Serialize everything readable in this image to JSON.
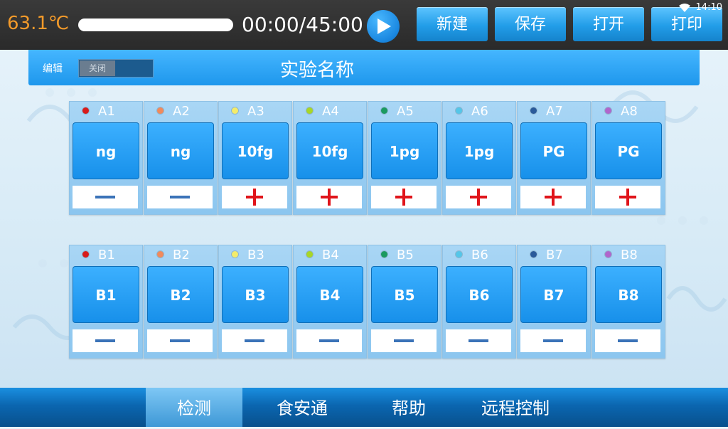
{
  "top": {
    "temperature": "63.1℃",
    "progress": 0.0,
    "timer": "00:00/45:00",
    "status_time": "14:10",
    "buttons": {
      "new": "新建",
      "save": "保存",
      "open": "打开",
      "print": "打印"
    }
  },
  "title_bar": {
    "edit_label": "编辑",
    "toggle_state": "关闭",
    "experiment_name": "实验名称"
  },
  "wells": {
    "row_a": [
      {
        "id": "A1",
        "name": "ng",
        "result": "negative",
        "dot": "#d81b1b"
      },
      {
        "id": "A2",
        "name": "ng",
        "result": "negative",
        "dot": "#f08a5d"
      },
      {
        "id": "A3",
        "name": "10fg",
        "result": "positive",
        "dot": "#f4ec6a"
      },
      {
        "id": "A4",
        "name": "10fg",
        "result": "positive",
        "dot": "#a8d628"
      },
      {
        "id": "A5",
        "name": "1pg",
        "result": "positive",
        "dot": "#1b9a60"
      },
      {
        "id": "A6",
        "name": "1pg",
        "result": "positive",
        "dot": "#55c6e8"
      },
      {
        "id": "A7",
        "name": "PG",
        "result": "positive",
        "dot": "#2a5a9a"
      },
      {
        "id": "A8",
        "name": "PG",
        "result": "positive",
        "dot": "#b066cc"
      }
    ],
    "row_b": [
      {
        "id": "B1",
        "name": "B1",
        "result": "negative",
        "dot": "#d81b1b"
      },
      {
        "id": "B2",
        "name": "B2",
        "result": "negative",
        "dot": "#f08a5d"
      },
      {
        "id": "B3",
        "name": "B3",
        "result": "negative",
        "dot": "#f4ec6a"
      },
      {
        "id": "B4",
        "name": "B4",
        "result": "negative",
        "dot": "#a8d628"
      },
      {
        "id": "B5",
        "name": "B5",
        "result": "negative",
        "dot": "#1b9a60"
      },
      {
        "id": "B6",
        "name": "B6",
        "result": "negative",
        "dot": "#55c6e8"
      },
      {
        "id": "B7",
        "name": "B7",
        "result": "negative",
        "dot": "#2a5a9a"
      },
      {
        "id": "B8",
        "name": "B8",
        "result": "negative",
        "dot": "#b066cc"
      }
    ]
  },
  "bottom_nav": {
    "active": "检测",
    "items": [
      "检测",
      "食安通",
      "帮助",
      "远程控制"
    ]
  },
  "colors": {
    "accent_blue": "#1e97ec",
    "temperature_orange": "#f39a2a",
    "positive_red": "#e0141a",
    "negative_blue": "#3b73b8"
  },
  "icons": {
    "play": "play-icon",
    "wifi": "wifi-icon"
  }
}
